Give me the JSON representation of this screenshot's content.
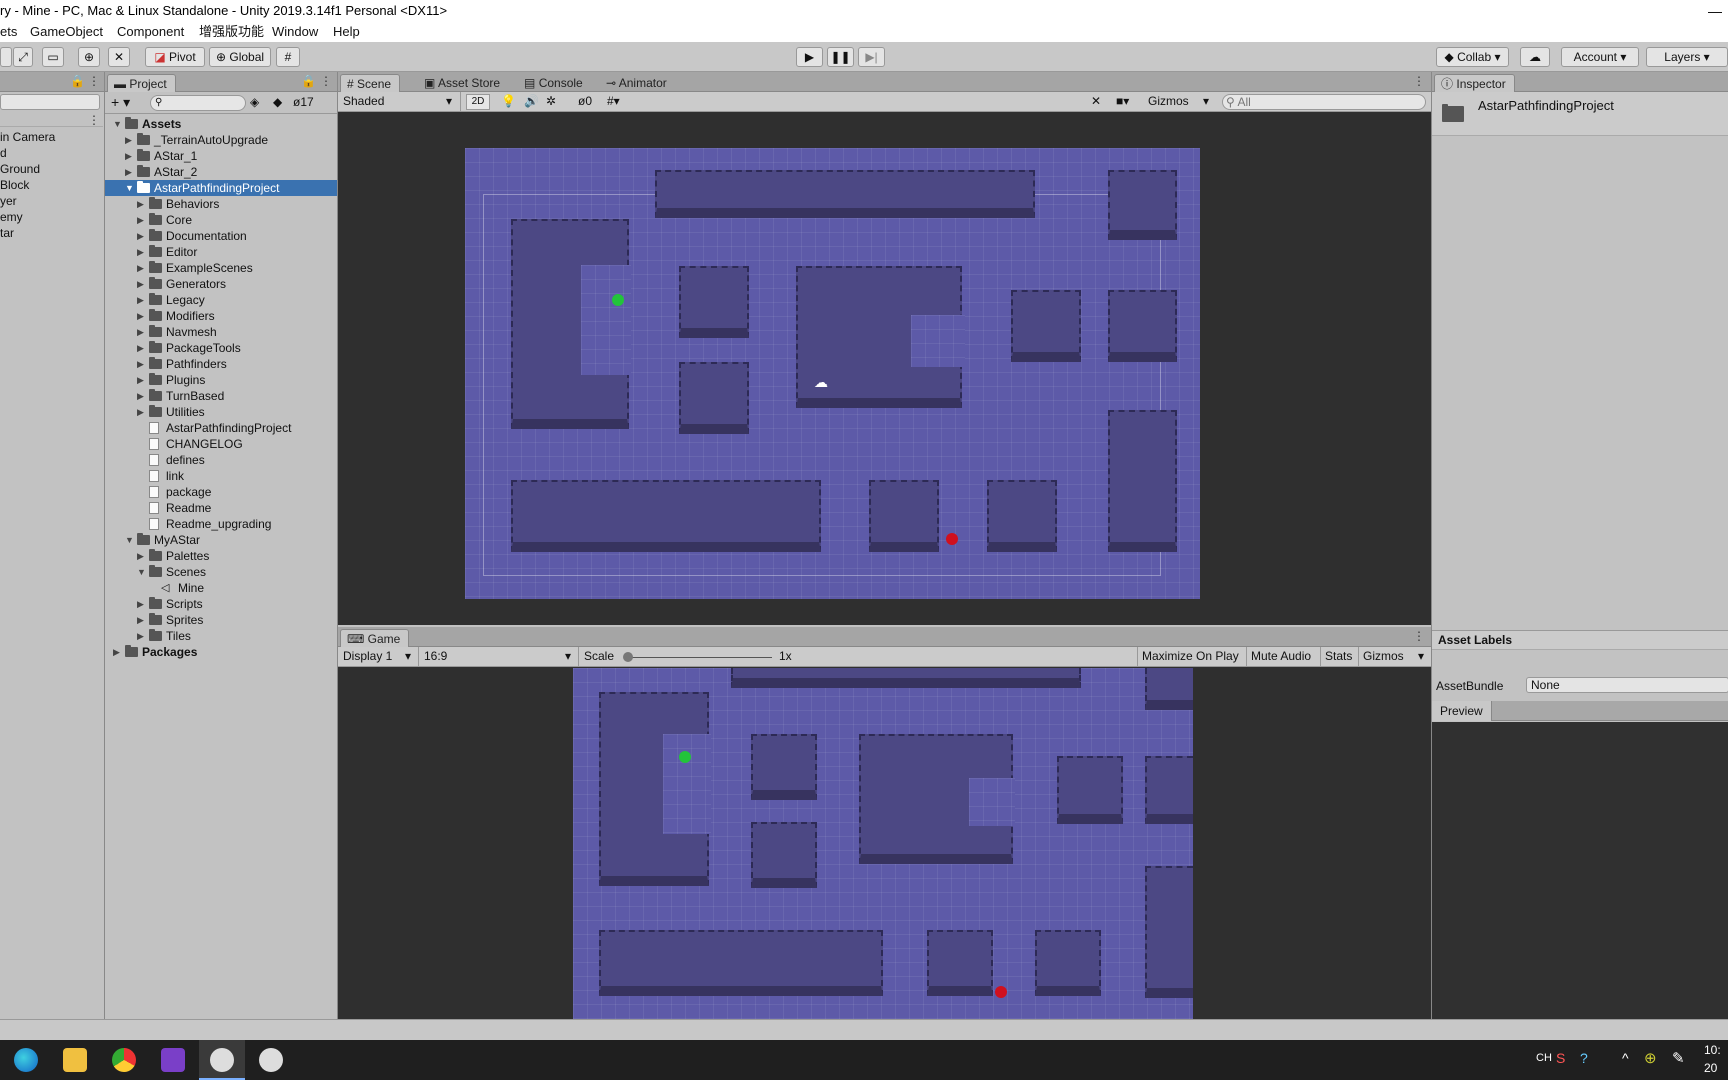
{
  "window": {
    "title": "ry - Mine - PC, Mac & Linux Standalone - Unity 2019.3.14f1 Personal <DX11>",
    "minimize": "—"
  },
  "menu": [
    "ets",
    "GameObject",
    "Component",
    "增强版功能",
    "Window",
    "Help"
  ],
  "toolbar": {
    "pivot": "Pivot",
    "global": "Global",
    "collab": "Collab",
    "account": "Account",
    "layers": "Layers"
  },
  "hierarchy": {
    "items": [
      "in Camera",
      "d",
      "Ground",
      "Block",
      "yer",
      "emy",
      "tar"
    ]
  },
  "project": {
    "tab": "Project",
    "count": "17",
    "tree": [
      {
        "label": "Assets",
        "depth": 0,
        "type": "folder",
        "arrow": "▼",
        "bold": true
      },
      {
        "label": "_TerrainAutoUpgrade",
        "depth": 1,
        "type": "folder",
        "arrow": "▶"
      },
      {
        "label": "AStar_1",
        "depth": 1,
        "type": "folder",
        "arrow": "▶"
      },
      {
        "label": "AStar_2",
        "depth": 1,
        "type": "folder",
        "arrow": "▶"
      },
      {
        "label": "AstarPathfindingProject",
        "depth": 1,
        "type": "folder",
        "arrow": "▼",
        "selected": true
      },
      {
        "label": "Behaviors",
        "depth": 2,
        "type": "folder",
        "arrow": "▶"
      },
      {
        "label": "Core",
        "depth": 2,
        "type": "folder",
        "arrow": "▶"
      },
      {
        "label": "Documentation",
        "depth": 2,
        "type": "folder",
        "arrow": "▶"
      },
      {
        "label": "Editor",
        "depth": 2,
        "type": "folder",
        "arrow": "▶"
      },
      {
        "label": "ExampleScenes",
        "depth": 2,
        "type": "folder",
        "arrow": "▶"
      },
      {
        "label": "Generators",
        "depth": 2,
        "type": "folder",
        "arrow": "▶"
      },
      {
        "label": "Legacy",
        "depth": 2,
        "type": "folder",
        "arrow": "▶"
      },
      {
        "label": "Modifiers",
        "depth": 2,
        "type": "folder",
        "arrow": "▶"
      },
      {
        "label": "Navmesh",
        "depth": 2,
        "type": "folder",
        "arrow": "▶"
      },
      {
        "label": "PackageTools",
        "depth": 2,
        "type": "folder",
        "arrow": "▶"
      },
      {
        "label": "Pathfinders",
        "depth": 2,
        "type": "folder",
        "arrow": "▶"
      },
      {
        "label": "Plugins",
        "depth": 2,
        "type": "folder",
        "arrow": "▶"
      },
      {
        "label": "TurnBased",
        "depth": 2,
        "type": "folder",
        "arrow": "▶"
      },
      {
        "label": "Utilities",
        "depth": 2,
        "type": "folder",
        "arrow": "▶"
      },
      {
        "label": "AstarPathfindingProject",
        "depth": 2,
        "type": "file",
        "arrow": ""
      },
      {
        "label": "CHANGELOG",
        "depth": 2,
        "type": "file",
        "arrow": ""
      },
      {
        "label": "defines",
        "depth": 2,
        "type": "file",
        "arrow": ""
      },
      {
        "label": "link",
        "depth": 2,
        "type": "file",
        "arrow": ""
      },
      {
        "label": "package",
        "depth": 2,
        "type": "file",
        "arrow": ""
      },
      {
        "label": "Readme",
        "depth": 2,
        "type": "file",
        "arrow": ""
      },
      {
        "label": "Readme_upgrading",
        "depth": 2,
        "type": "file",
        "arrow": ""
      },
      {
        "label": "MyAStar",
        "depth": 1,
        "type": "folder",
        "arrow": "▼"
      },
      {
        "label": "Palettes",
        "depth": 2,
        "type": "folder",
        "arrow": "▶"
      },
      {
        "label": "Scenes",
        "depth": 2,
        "type": "folder",
        "arrow": "▼"
      },
      {
        "label": "Mine",
        "depth": 3,
        "type": "scene",
        "arrow": ""
      },
      {
        "label": "Scripts",
        "depth": 2,
        "type": "folder",
        "arrow": "▶"
      },
      {
        "label": "Sprites",
        "depth": 2,
        "type": "folder",
        "arrow": "▶"
      },
      {
        "label": "Tiles",
        "depth": 2,
        "type": "folder",
        "arrow": "▶"
      },
      {
        "label": "Packages",
        "depth": 0,
        "type": "folder",
        "arrow": "▶",
        "bold": true
      }
    ]
  },
  "scene": {
    "tabs": [
      "Scene",
      "Asset Store",
      "Console",
      "Animator"
    ],
    "shading": "Shaded",
    "mode_2d": "2D",
    "hidden_count": "0",
    "gizmos": "Gizmos",
    "search_placeholder": "All"
  },
  "game": {
    "tab": "Game",
    "display": "Display 1",
    "aspect": "16:9",
    "scale_label": "Scale",
    "scale_value": "1x",
    "maximize": "Maximize On Play",
    "mute": "Mute Audio",
    "stats": "Stats",
    "gizmos": "Gizmos"
  },
  "inspector": {
    "tab": "Inspector",
    "object_name": "AstarPathfindingProject",
    "asset_labels": "Asset Labels",
    "asset_bundle_label": "AssetBundle",
    "asset_bundle_value": "None",
    "preview": "Preview"
  },
  "taskbar": {
    "ime": "CH",
    "time": "10:",
    "date": "20"
  },
  "colors": {
    "selection": "#3a72b0",
    "tile": "#5d5aa8",
    "start_marker": "#22c43a",
    "end_marker": "#d0101e"
  }
}
